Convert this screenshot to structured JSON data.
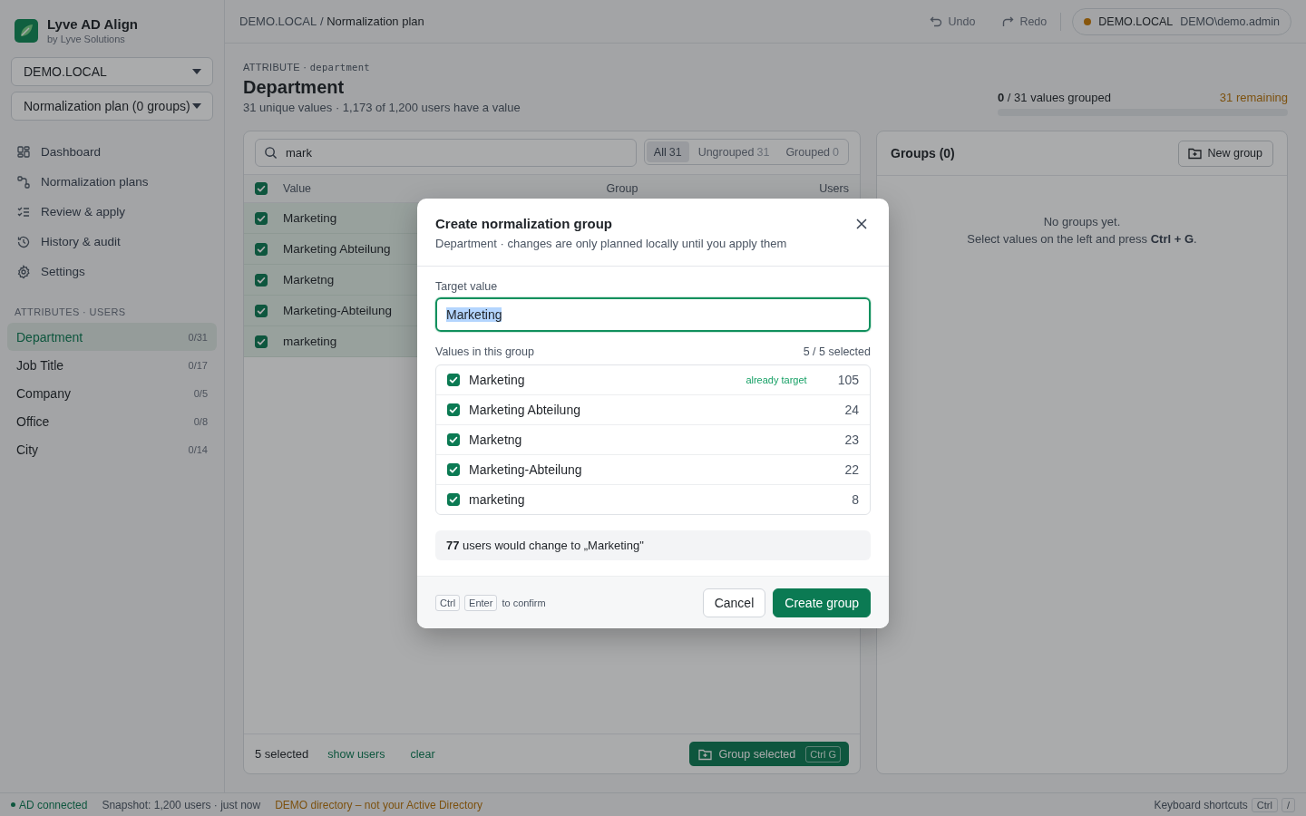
{
  "app": {
    "name": "Lyve AD Align",
    "byline": "by Lyve Solutions"
  },
  "sidebar": {
    "domain_select": "DEMO.LOCAL",
    "plan_select": "Normalization plan (0 groups)",
    "nav": [
      {
        "label": "Dashboard"
      },
      {
        "label": "Normalization plans"
      },
      {
        "label": "Review & apply"
      },
      {
        "label": "History & audit"
      },
      {
        "label": "Settings"
      }
    ],
    "attributes_heading": "ATTRIBUTES · USERS",
    "attributes": [
      {
        "label": "Department",
        "count": "0/31",
        "selected": true
      },
      {
        "label": "Job Title",
        "count": "0/17",
        "selected": false
      },
      {
        "label": "Company",
        "count": "0/5",
        "selected": false
      },
      {
        "label": "Office",
        "count": "0/8",
        "selected": false
      },
      {
        "label": "City",
        "count": "0/14",
        "selected": false
      }
    ]
  },
  "topbar": {
    "breadcrumb_parent": "DEMO.LOCAL",
    "breadcrumb_separator": "/",
    "breadcrumb_current": "Normalization plan",
    "undo": "Undo",
    "redo": "Redo",
    "connection_domain": "DEMO.LOCAL",
    "connection_user": "DEMO\\demo.admin"
  },
  "header": {
    "overline": "ATTRIBUTE ·",
    "attribute_key": "department",
    "title": "Department",
    "subtitle": "31 unique values · 1,173 of 1,200 users have a value",
    "progress_text": "**0** / 31 values grouped",
    "remaining": "31 remaining",
    "level": 0
  },
  "values_panel": {
    "search": {
      "value": "mark"
    },
    "filters": [
      {
        "label": "All",
        "count": "31",
        "selected": true
      },
      {
        "label": "Ungrouped",
        "count": "31",
        "selected": false
      },
      {
        "label": "Grouped",
        "count": "0",
        "selected": false
      }
    ],
    "columns": [
      "Value",
      "Group",
      "Users"
    ],
    "header_checked": true,
    "rows": [
      {
        "value": "Marketing",
        "checked": true
      },
      {
        "value": "Marketing Abteilung",
        "checked": true
      },
      {
        "value": "Marketng",
        "checked": true
      },
      {
        "value": "Marketing-Abteilung",
        "checked": true
      },
      {
        "value": "marketing",
        "checked": true
      }
    ],
    "selected_text": "5 selected",
    "show_users": "show users",
    "clear": "clear",
    "group_button": "Group selected",
    "group_shortcut": "Ctrl G"
  },
  "groups_panel": {
    "title": "Groups (0)",
    "new_group": "New group",
    "empty_title": "No groups yet.",
    "empty_hint": "Select values on the left and press **Ctrl + G**."
  },
  "dialog": {
    "title": "Create normalization group",
    "subtitle": "Department · changes are only planned locally until you apply them",
    "target_label": "Target value",
    "target_value": "Marketing",
    "values_label": "Values in this group",
    "selected_count": "5 / 5 selected",
    "items": [
      {
        "value": "Marketing",
        "note": "already target",
        "count": "105",
        "checked": true
      },
      {
        "value": "Marketing Abteilung",
        "count": "24",
        "checked": true
      },
      {
        "value": "Marketng",
        "count": "23",
        "checked": true
      },
      {
        "value": "Marketing-Abteilung",
        "count": "22",
        "checked": true
      },
      {
        "value": "marketing",
        "count": "8",
        "checked": true
      }
    ],
    "summary": "**77** users would change to „Marketing\"",
    "keys": [
      "Ctrl",
      "Enter"
    ],
    "keys_hint": "to confirm",
    "cancel": "Cancel",
    "confirm": "Create group"
  },
  "status_bar": {
    "connected": "AD connected",
    "snapshot": "Snapshot: 1,200 users · just now",
    "warning": "DEMO directory – not your Active Directory",
    "shortcuts_label": "Keyboard shortcuts",
    "keys": [
      "Ctrl",
      "/"
    ]
  }
}
